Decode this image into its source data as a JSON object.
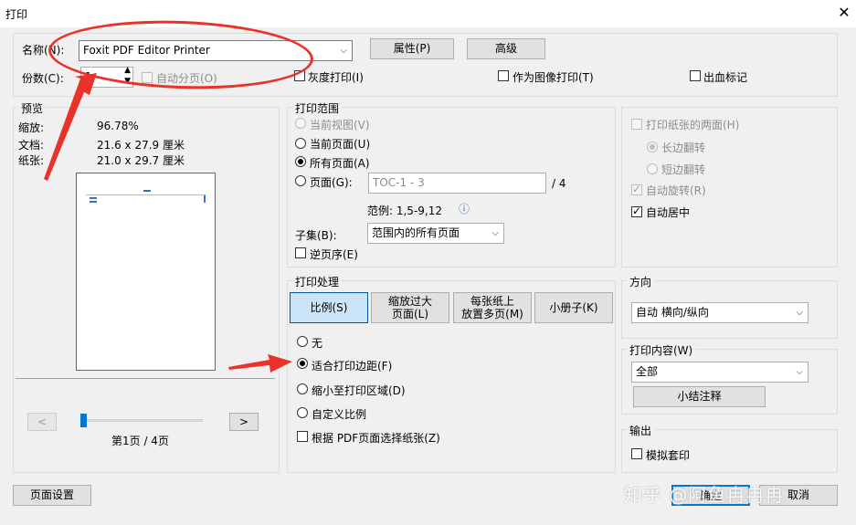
{
  "window": {
    "title": "打印",
    "close_glyph": "✕"
  },
  "printer": {
    "name_label": "名称(N):",
    "name_value": "Foxit PDF Editor Printer",
    "properties_btn": "属性(P)",
    "advanced_btn": "高级",
    "copies_label": "份数(C):",
    "copies_value": "1",
    "collate_label": "自动分页(O)",
    "grayscale_label": "灰度打印(I)",
    "print_as_image_label": "作为图像打印(T)",
    "bleed_marks_label": "出血标记"
  },
  "preview": {
    "group_label": "预览",
    "zoom_label": "缩放:",
    "zoom_value": "96.78%",
    "document_label": "文档:",
    "document_value": "21.6 x 27.9 厘米",
    "paper_label": "纸张:",
    "paper_value": "21.0 x 29.7 厘米",
    "prev_btn": "<",
    "next_btn": ">",
    "page_indicator": "第1页 / 4页",
    "slider_position": 0.0
  },
  "range": {
    "group_label": "打印范围",
    "current_view": "当前视图(V)",
    "current_page": "当前页面(U)",
    "all_pages": "所有页面(A)",
    "pages_label": "页面(G):",
    "pages_placeholder": "TOC-1 - 3",
    "pages_total": "/ 4",
    "example": "范例: 1,5-9,12",
    "info_glyph": "ⓘ",
    "subset_label": "子集(B):",
    "subset_value": "范围内的所有页面",
    "reverse_label": "逆页序(E)"
  },
  "duplex": {
    "both_sides": "打印纸张的两面(H)",
    "long_edge": "长边翻转",
    "short_edge": "短边翻转",
    "auto_rotate": "自动旋转(R)",
    "auto_center": "自动居中"
  },
  "handling": {
    "group_label": "打印处理",
    "tabs": [
      "比例(S)",
      "缩放过大页面(L)",
      "每张纸上放置多页(M)",
      "小册子(K)"
    ],
    "tab1_line1": "缩放过大",
    "tab1_line2": "页面(L)",
    "tab2_line1": "每张纸上",
    "tab2_line2": "放置多页(M)",
    "opt_none": "无",
    "opt_fit_margins": "适合打印边距(F)",
    "opt_shrink": "缩小至打印区域(D)",
    "opt_custom": "自定义比例",
    "choose_paper": "根据 PDF页面选择纸张(Z)"
  },
  "orientation": {
    "group_label": "方向",
    "value": "自动 横向/纵向"
  },
  "content": {
    "group_label": "打印内容(W)",
    "value": "全部",
    "summary_btn": "小结注释"
  },
  "output": {
    "group_label": "输出",
    "simulate_overprint": "模拟套印"
  },
  "footer": {
    "page_setup_btn": "页面设置",
    "ok_btn": "确定",
    "cancel_btn": "取消"
  },
  "watermark": "知乎 @阿鱼冉冉冉",
  "colors": {
    "annotation": "#e8322a",
    "active_tab": "#cce4f7",
    "selection": "#cce4f7"
  }
}
